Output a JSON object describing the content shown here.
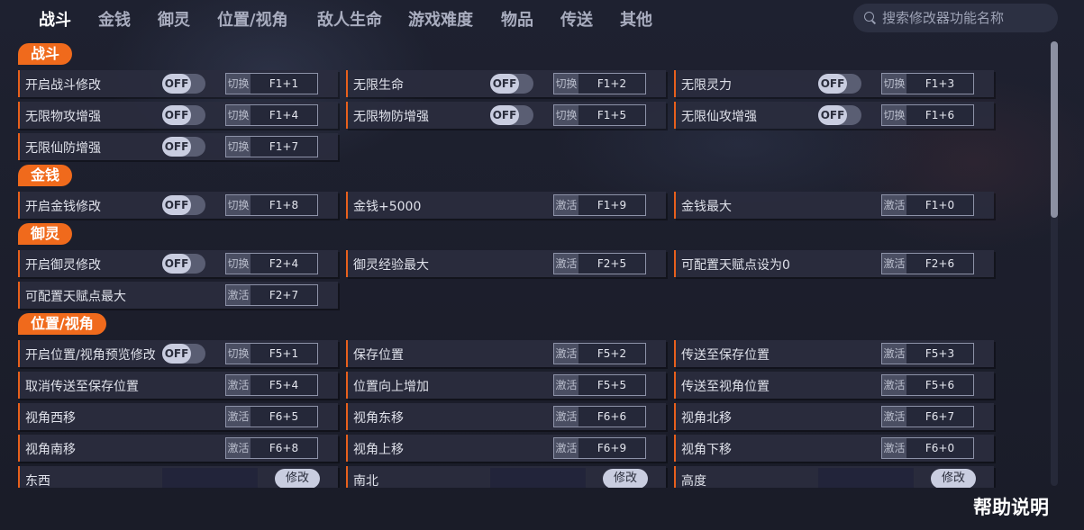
{
  "nav": {
    "tabs": [
      "战斗",
      "金钱",
      "御灵",
      "位置/视角",
      "敌人生命",
      "游戏难度",
      "物品",
      "传送",
      "其他"
    ],
    "active_tab": "战斗"
  },
  "search": {
    "placeholder": "搜索修改器功能名称"
  },
  "sections": [
    {
      "title": "战斗",
      "rows": [
        {
          "label": "开启战斗修改",
          "toggle": "OFF",
          "mode": "切换",
          "key": "F1+1"
        },
        {
          "label": "无限生命",
          "toggle": "OFF",
          "mode": "切换",
          "key": "F1+2"
        },
        {
          "label": "无限灵力",
          "toggle": "OFF",
          "mode": "切换",
          "key": "F1+3"
        },
        {
          "label": "无限物攻增强",
          "toggle": "OFF",
          "mode": "切换",
          "key": "F1+4"
        },
        {
          "label": "无限物防增强",
          "toggle": "OFF",
          "mode": "切换",
          "key": "F1+5"
        },
        {
          "label": "无限仙攻增强",
          "toggle": "OFF",
          "mode": "切换",
          "key": "F1+6"
        },
        {
          "label": "无限仙防增强",
          "toggle": "OFF",
          "mode": "切换",
          "key": "F1+7"
        }
      ]
    },
    {
      "title": "金钱",
      "rows": [
        {
          "label": "开启金钱修改",
          "toggle": "OFF",
          "mode": "切换",
          "key": "F1+8"
        },
        {
          "label": "金钱+5000",
          "mode": "激活",
          "key": "F1+9"
        },
        {
          "label": "金钱最大",
          "mode": "激活",
          "key": "F1+0"
        }
      ]
    },
    {
      "title": "御灵",
      "rows": [
        {
          "label": "开启御灵修改",
          "toggle": "OFF",
          "mode": "切换",
          "key": "F2+4"
        },
        {
          "label": "御灵经验最大",
          "mode": "激活",
          "key": "F2+5"
        },
        {
          "label": "可配置天赋点设为0",
          "mode": "激活",
          "key": "F2+6"
        },
        {
          "label": "可配置天赋点最大",
          "mode": "激活",
          "key": "F2+7"
        }
      ]
    },
    {
      "title": "位置/视角",
      "rows": [
        {
          "label": "开启位置/视角预览修改",
          "toggle": "OFF",
          "mode": "切换",
          "key": "F5+1"
        },
        {
          "label": "保存位置",
          "mode": "激活",
          "key": "F5+2"
        },
        {
          "label": "传送至保存位置",
          "mode": "激活",
          "key": "F5+3"
        },
        {
          "label": "取消传送至保存位置",
          "mode": "激活",
          "key": "F5+4"
        },
        {
          "label": "位置向上增加",
          "mode": "激活",
          "key": "F5+5"
        },
        {
          "label": "传送至视角位置",
          "mode": "激活",
          "key": "F5+6"
        },
        {
          "label": "视角西移",
          "mode": "激活",
          "key": "F6+5"
        },
        {
          "label": "视角东移",
          "mode": "激活",
          "key": "F6+6"
        },
        {
          "label": "视角北移",
          "mode": "激活",
          "key": "F6+7"
        },
        {
          "label": "视角南移",
          "mode": "激活",
          "key": "F6+8"
        },
        {
          "label": "视角上移",
          "mode": "激活",
          "key": "F6+9"
        },
        {
          "label": "视角下移",
          "mode": "激活",
          "key": "F6+0"
        },
        {
          "label": "东西",
          "edit_button": "修改"
        },
        {
          "label": "南北",
          "edit_button": "修改"
        },
        {
          "label": "高度",
          "edit_button": "修改"
        }
      ]
    }
  ],
  "footer": {
    "help_label": "帮助说明"
  },
  "colors": {
    "accent": "#f06a1c",
    "background": "#1b1d2a",
    "row": "#2a2d3e"
  }
}
